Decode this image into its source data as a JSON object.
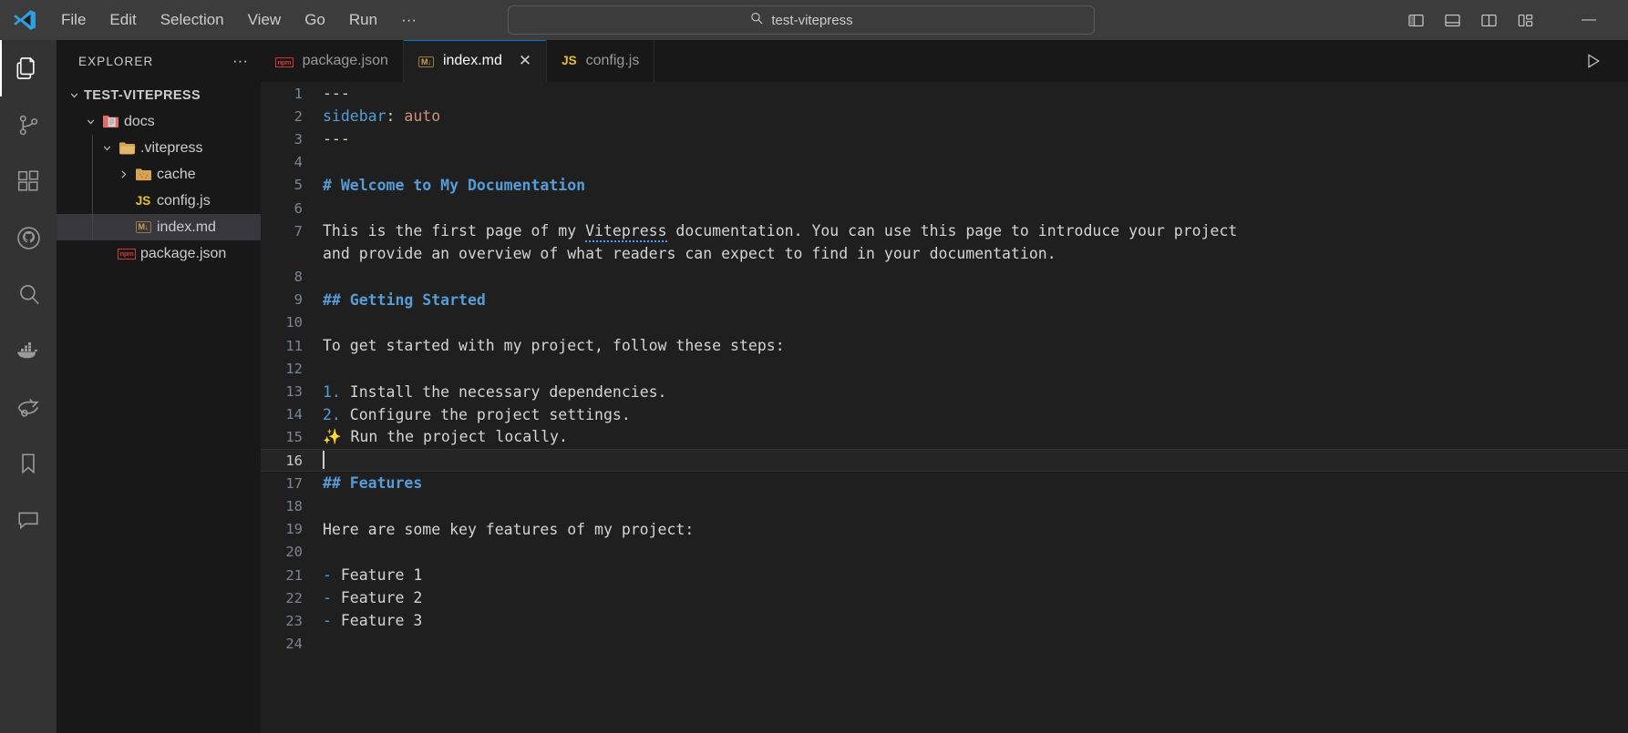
{
  "titlebar": {
    "logo_icon": "vscode-logo",
    "menus": [
      {
        "label": "File",
        "name": "menu-file"
      },
      {
        "label": "Edit",
        "name": "menu-edit"
      },
      {
        "label": "Selection",
        "name": "menu-selection"
      },
      {
        "label": "View",
        "name": "menu-view"
      },
      {
        "label": "Go",
        "name": "menu-go"
      },
      {
        "label": "Run",
        "name": "menu-run"
      },
      {
        "label": "···",
        "name": "menu-more"
      }
    ],
    "back_icon": "arrow-left-icon",
    "forward_icon": "arrow-right-icon",
    "command_center": {
      "search_icon": "search-icon",
      "value": "test-vitepress"
    },
    "layout_buttons": [
      {
        "name": "toggle-primary-sidebar-button",
        "icon": "layout-sidebar-left-icon"
      },
      {
        "name": "toggle-panel-button",
        "icon": "layout-panel-icon"
      },
      {
        "name": "toggle-secondary-sidebar-button",
        "icon": "layout-sidebar-right-icon"
      },
      {
        "name": "customize-layout-button",
        "icon": "layout-grid-icon"
      }
    ],
    "minimize_label": "—"
  },
  "activitybar": {
    "items": [
      {
        "name": "activity-explorer",
        "icon": "files-icon",
        "active": true
      },
      {
        "name": "activity-source-control",
        "icon": "source-control-icon",
        "active": false
      },
      {
        "name": "activity-extensions",
        "icon": "extensions-icon",
        "active": false
      },
      {
        "name": "activity-github",
        "icon": "github-icon",
        "active": false
      },
      {
        "name": "activity-search",
        "icon": "search-icon",
        "active": false
      },
      {
        "name": "activity-docker",
        "icon": "docker-whale-icon",
        "active": false
      },
      {
        "name": "activity-liveshare",
        "icon": "live-share-icon",
        "active": false
      },
      {
        "name": "activity-bookmarks",
        "icon": "bookmark-icon",
        "active": false
      },
      {
        "name": "activity-comments",
        "icon": "comment-icon",
        "active": false
      }
    ]
  },
  "sidebar": {
    "title": "EXPLORER",
    "more_actions_icon": "ellipsis-icon",
    "tree": [
      {
        "name": "tree-root-test-vitepress",
        "label": "TEST-VITEPRESS",
        "depth": 0,
        "twisty": "chevron-down-icon",
        "icon": "none",
        "kind": "root",
        "selected": false
      },
      {
        "name": "tree-folder-docs",
        "label": "docs",
        "depth": 1,
        "twisty": "chevron-down-icon",
        "icon": "folder-docs-icon",
        "kind": "folder",
        "selected": false
      },
      {
        "name": "tree-folder-vitepress",
        "label": ".vitepress",
        "depth": 2,
        "twisty": "chevron-down-icon",
        "icon": "folder-open-icon",
        "kind": "folder",
        "selected": false
      },
      {
        "name": "tree-folder-cache",
        "label": "cache",
        "depth": 3,
        "twisty": "chevron-right-icon",
        "icon": "folder-cache-icon",
        "kind": "folder",
        "selected": false
      },
      {
        "name": "tree-file-config-js",
        "label": "config.js",
        "depth": 3,
        "twisty": "none",
        "icon": "js-file-icon",
        "kind": "file",
        "selected": false
      },
      {
        "name": "tree-file-index-md",
        "label": "index.md",
        "depth": 3,
        "twisty": "none",
        "icon": "markdown-file-icon",
        "kind": "file",
        "selected": true
      },
      {
        "name": "tree-file-package-json",
        "label": "package.json",
        "depth": 2,
        "twisty": "none",
        "icon": "npm-file-icon",
        "kind": "file",
        "selected": false
      }
    ]
  },
  "tabs": [
    {
      "name": "tab-package-json",
      "label": "package.json",
      "icon": "npm-file-icon",
      "active": false,
      "closable": false
    },
    {
      "name": "tab-index-md",
      "label": "index.md",
      "icon": "markdown-file-icon",
      "active": true,
      "closable": true,
      "close_label": "✕"
    },
    {
      "name": "tab-config-js",
      "label": "config.js",
      "icon": "js-file-icon",
      "active": false,
      "closable": false
    }
  ],
  "editor_actions": {
    "run_icon": "run-play-icon"
  },
  "editor": {
    "filename": "index.md",
    "cursor_line": 16,
    "lines": [
      {
        "n": 1,
        "type": "frontmatter-rule",
        "text": "---"
      },
      {
        "n": 2,
        "type": "yaml",
        "key": "sidebar",
        "sep": ": ",
        "value": "auto"
      },
      {
        "n": 3,
        "type": "frontmatter-rule",
        "text": "---"
      },
      {
        "n": 4,
        "type": "blank",
        "text": ""
      },
      {
        "n": 5,
        "type": "heading",
        "text": "# Welcome to My Documentation"
      },
      {
        "n": 6,
        "type": "blank",
        "text": ""
      },
      {
        "n": 7,
        "type": "paragraph-spell",
        "pre": "This is the first page of my ",
        "misspelled": "Vitepress",
        "post": " documentation. You can use this page to introduce your project"
      },
      {
        "n": 7,
        "type": "wrapped",
        "text": "and provide an overview of what readers can expect to find in your documentation.",
        "continuation": true
      },
      {
        "n": 8,
        "type": "blank",
        "text": ""
      },
      {
        "n": 9,
        "type": "heading",
        "text": "## Getting Started"
      },
      {
        "n": 10,
        "type": "blank",
        "text": ""
      },
      {
        "n": 11,
        "type": "paragraph",
        "text": "To get started with my project, follow these steps:"
      },
      {
        "n": 12,
        "type": "blank",
        "text": ""
      },
      {
        "n": 13,
        "type": "ordered-item",
        "marker": "1.",
        "text": " Install the necessary dependencies."
      },
      {
        "n": 14,
        "type": "ordered-item",
        "marker": "2.",
        "text": " Configure the project settings."
      },
      {
        "n": 15,
        "type": "emoji-item",
        "marker": "✨",
        "text": " Run the project locally."
      },
      {
        "n": 16,
        "type": "cursor-line",
        "text": ""
      },
      {
        "n": 17,
        "type": "heading",
        "text": "## Features"
      },
      {
        "n": 18,
        "type": "blank",
        "text": ""
      },
      {
        "n": 19,
        "type": "paragraph",
        "text": "Here are some key features of my project:"
      },
      {
        "n": 20,
        "type": "blank",
        "text": ""
      },
      {
        "n": 21,
        "type": "bullet-item",
        "marker": "-",
        "text": " Feature 1"
      },
      {
        "n": 22,
        "type": "bullet-item",
        "marker": "-",
        "text": " Feature 2"
      },
      {
        "n": 23,
        "type": "bullet-item",
        "marker": "-",
        "text": " Feature 3"
      },
      {
        "n": 24,
        "type": "blank",
        "text": ""
      }
    ]
  },
  "colors": {
    "accent": "#0078d4",
    "heading": "#569cd6",
    "string": "#ce9178",
    "editor_bg": "#1f1f1f",
    "sidebar_bg": "#181818",
    "titlebar_bg": "#3c3c3c",
    "activitybar_bg": "#333333",
    "selection_bg": "#37373d"
  }
}
